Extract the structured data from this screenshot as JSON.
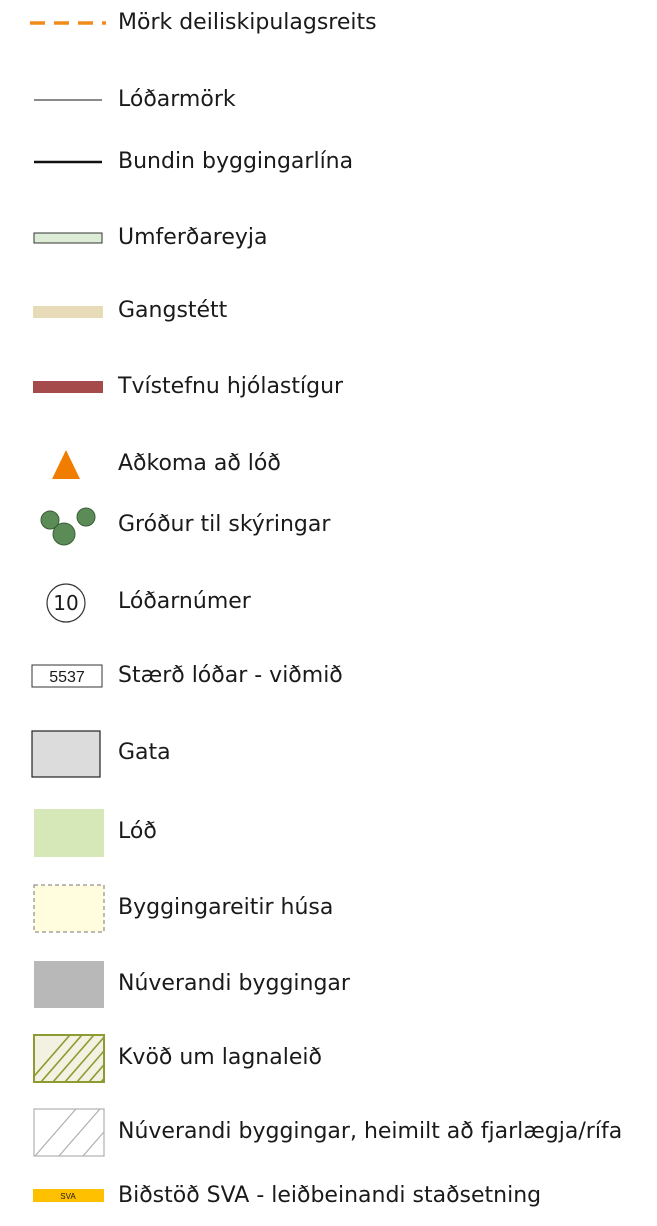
{
  "legend": {
    "items": [
      {
        "symbol": "orange-dashed-line",
        "label": "Mörk deiliskipulagsreits",
        "color": "#f28a1c"
      },
      {
        "symbol": "thin-line",
        "label": "Lóðarmörk",
        "color": "#444444"
      },
      {
        "symbol": "thick-line",
        "label": "Bundin byggingarlína",
        "color": "#111111"
      },
      {
        "symbol": "traffic-island",
        "label": "Umferðareyja",
        "color": "#dcecd6"
      },
      {
        "symbol": "sidewalk",
        "label": "Gangstétt",
        "color": "#e8dcb8"
      },
      {
        "symbol": "bike-path",
        "label": "Tvístefnu hjólastígur",
        "color": "#a64b4b"
      },
      {
        "symbol": "access-triangle",
        "label": "Aðkoma að lóð",
        "color": "#f07c00"
      },
      {
        "symbol": "vegetation-circles",
        "label": "Gróður til skýringar",
        "color": "#5b8b56"
      },
      {
        "symbol": "lot-number-circle",
        "label": "Lóðarnúmer",
        "number": "10"
      },
      {
        "symbol": "lot-size-box",
        "label": "Stærð lóðar - viðmið",
        "number": "5537"
      },
      {
        "symbol": "street-box",
        "label": "Gata",
        "color": "#dcdcdc"
      },
      {
        "symbol": "lot-box",
        "label": "Lóð",
        "color": "#d6e7b8"
      },
      {
        "symbol": "building-area-box",
        "label": "Byggingareitir húsa",
        "color": "#fffddd"
      },
      {
        "symbol": "existing-building-box",
        "label": "Núverandi byggingar",
        "color": "#b8b8b8"
      },
      {
        "symbol": "utility-easement-hatch",
        "label": "Kvöð um lagnaleið",
        "color": "#8e9a32"
      },
      {
        "symbol": "removable-building-hatch",
        "label": "Núverandi byggingar, heimilt að  fjarlægja/rífa",
        "color": "#b0b0b0"
      },
      {
        "symbol": "substation-bar",
        "label": "Biðstöð SVA - leiðbeinandi staðsetning",
        "plate_text": "SVA",
        "color": "#ffc000"
      }
    ]
  }
}
